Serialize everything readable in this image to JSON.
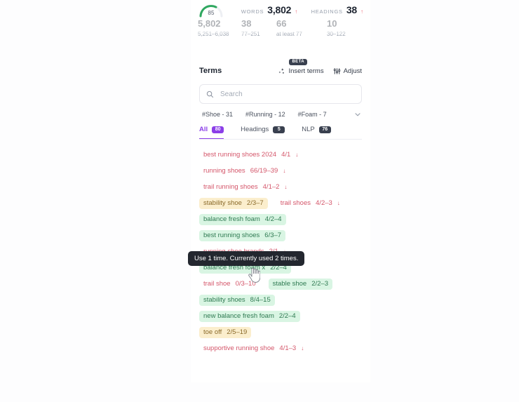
{
  "header": {
    "score": "85",
    "stats": [
      {
        "label": "WORDS",
        "value": "3,802",
        "arrow": "↑",
        "range": "5,251–6,038"
      },
      {
        "label": "HEADINGS",
        "value": "38",
        "arrow": "↑",
        "range": "77–251"
      }
    ],
    "ghost_row": [
      "5,802",
      "38",
      "66",
      "10"
    ],
    "ranges": [
      "5,251–6,038",
      "77–251",
      "at least 77",
      "30–122"
    ]
  },
  "terms_panel": {
    "title": "Terms",
    "insert_terms_label": "Insert terms",
    "insert_terms_badge": "BETA",
    "adjust_label": "Adjust",
    "search": {
      "placeholder": "Search",
      "value": ""
    },
    "tags": [
      {
        "label": "#Shoe - 31"
      },
      {
        "label": "#Running - 12"
      },
      {
        "label": "#Foam - 7"
      }
    ],
    "tabs": [
      {
        "label": "All",
        "badge": "80",
        "active": true
      },
      {
        "label": "Headings",
        "badge": "5",
        "active": false
      },
      {
        "label": "NLP",
        "badge": "76",
        "active": false
      }
    ],
    "rows": [
      [
        {
          "text": "best running shoes 2024",
          "count": "4/1",
          "arrow": "↓",
          "style": "plain"
        }
      ],
      [
        {
          "text": "running shoes",
          "count": "66/19–39",
          "arrow": "↓",
          "style": "plain"
        }
      ],
      [
        {
          "text": "trail running shoes",
          "count": "4/1–2",
          "arrow": "↓",
          "style": "plain"
        }
      ],
      [
        {
          "text": "stability shoe",
          "count": "2/3–7",
          "arrow": "",
          "style": "yellow"
        },
        {
          "text": "trail shoes",
          "count": "4/2–3",
          "arrow": "↓",
          "style": "plain"
        }
      ],
      [
        {
          "text": "balance fresh foam",
          "count": "4/2–4",
          "arrow": "",
          "style": "green"
        }
      ],
      [
        {
          "text": "best running shoes",
          "count": "6/3–7",
          "arrow": "",
          "style": "green"
        }
      ],
      [
        {
          "text": "running shoe brands",
          "count": "2/1",
          "arrow": "↓",
          "style": "plain"
        }
      ],
      [
        {
          "text": "balance fresh foam x",
          "count": "2/2–4",
          "arrow": "",
          "style": "green"
        }
      ],
      [
        {
          "text": "trail shoe",
          "count": "0/3–10",
          "arrow": "",
          "style": "plain"
        },
        {
          "text": "stable shoe",
          "count": "2/2–3",
          "arrow": "",
          "style": "green"
        }
      ],
      [
        {
          "text": "stability shoes",
          "count": "8/4–15",
          "arrow": "",
          "style": "green"
        }
      ],
      [
        {
          "text": "new balance fresh foam",
          "count": "2/2–4",
          "arrow": "",
          "style": "green"
        }
      ],
      [
        {
          "text": "toe off",
          "count": "2/5–19",
          "arrow": "",
          "style": "yellow"
        }
      ],
      [
        {
          "text": "supportive running shoe",
          "count": "4/1–3",
          "arrow": "↓",
          "style": "plain"
        }
      ]
    ]
  },
  "tooltip": {
    "text": "Use 1 time. Currently used 2 times."
  },
  "colors": {
    "accent": "#8b3fe8",
    "gauge": "#2fa85f",
    "over": "#d4566a",
    "good": "#2f7a52",
    "warn": "#8a6a2a"
  }
}
